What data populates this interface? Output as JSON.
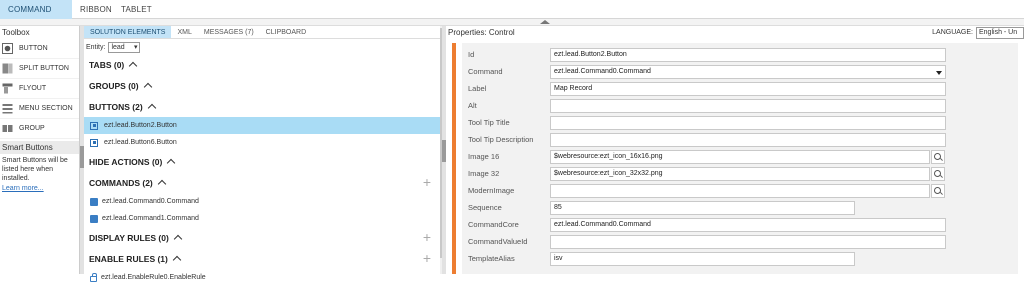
{
  "top_tabs": [
    "COMMAND BAR",
    "RIBBON",
    "TABLET"
  ],
  "toolbox": {
    "title": "Toolbox",
    "items": [
      {
        "label": "BUTTON",
        "icon": "button-icon"
      },
      {
        "label": "SPLIT BUTTON",
        "icon": "split-button-icon"
      },
      {
        "label": "FLYOUT",
        "icon": "flyout-icon"
      },
      {
        "label": "MENU SECTION",
        "icon": "menu-section-icon"
      },
      {
        "label": "GROUP",
        "icon": "group-icon"
      }
    ],
    "smart_header": "Smart Buttons",
    "smart_text": "Smart Buttons will be listed here when installed.",
    "smart_link": "Learn more..."
  },
  "solution": {
    "tabs": [
      "SOLUTION ELEMENTS",
      "XML",
      "MESSAGES (7)",
      "CLIPBOARD"
    ],
    "entity_label": "Entity:",
    "entity_value": "lead",
    "sections": {
      "tabs": "TABS (0)",
      "groups": "GROUPS (0)",
      "buttons": "BUTTONS (2)",
      "hide_actions": "HIDE ACTIONS (0)",
      "commands": "COMMANDS (2)",
      "display_rules": "DISPLAY RULES (0)",
      "enable_rules": "ENABLE RULES (1)"
    },
    "buttons": [
      "ezt.lead.Button2.Button",
      "ezt.lead.Button6.Button"
    ],
    "commands": [
      "ezt.lead.Command0.Command",
      "ezt.lead.Command1.Command"
    ],
    "enable_rules": [
      "ezt.lead.EnableRule0.EnableRule"
    ]
  },
  "properties": {
    "title": "Properties: Control",
    "language_label": "LANGUAGE:",
    "language_value": "English - Un",
    "fields": {
      "id": {
        "label": "Id",
        "value": "ezt.lead.Button2.Button"
      },
      "command": {
        "label": "Command",
        "value": "ezt.lead.Command0.Command"
      },
      "label": {
        "label": "Label",
        "value": "Map Record"
      },
      "alt": {
        "label": "Alt",
        "value": ""
      },
      "tooltip_title": {
        "label": "Tool Tip Title",
        "value": ""
      },
      "tooltip_desc": {
        "label": "Tool Tip Description",
        "value": ""
      },
      "image16": {
        "label": "Image 16",
        "value": "$webresource:ezt_icon_16x16.png"
      },
      "image32": {
        "label": "Image 32",
        "value": "$webresource:ezt_icon_32x32.png"
      },
      "modern_image": {
        "label": "ModernImage",
        "value": ""
      },
      "sequence": {
        "label": "Sequence",
        "value": "85"
      },
      "command_core": {
        "label": "CommandCore",
        "value": "ezt.lead.Command0.Command"
      },
      "command_value_id": {
        "label": "CommandValueId",
        "value": ""
      },
      "template_alias": {
        "label": "TemplateAlias",
        "value": "isv"
      }
    }
  }
}
